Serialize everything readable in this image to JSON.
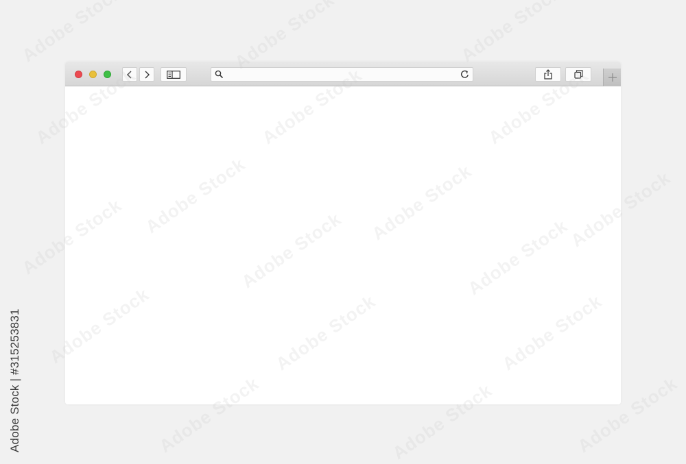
{
  "browser": {
    "address_bar": {
      "value": "",
      "placeholder": ""
    },
    "icons": {
      "back": "chevron-left-icon",
      "forward": "chevron-right-icon",
      "sidebar": "sidebar-icon",
      "search": "search-icon",
      "reload": "reload-icon",
      "share": "share-icon",
      "tabs": "tabs-overview-icon",
      "new_tab": "plus-icon"
    },
    "colors": {
      "close": "#ec4a51",
      "minimize": "#e9c03b",
      "maximize": "#3fbf45",
      "toolbar": "#dcdcdc",
      "background": "#f1f1f1"
    }
  },
  "watermark": {
    "text": "Adobe Stock"
  },
  "caption": {
    "text": "Adobe Stock | #315253831"
  }
}
